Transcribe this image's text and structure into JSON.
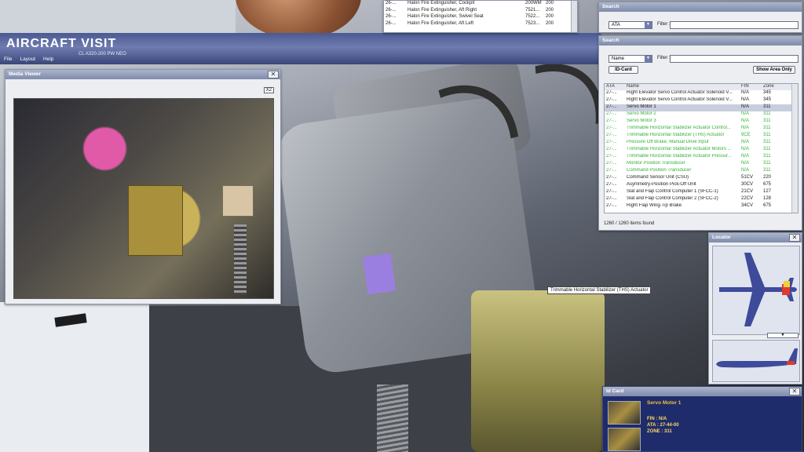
{
  "app": {
    "title": "AIRCRAFT VISIT",
    "subtitle": "CL A320-200 PW NEO"
  },
  "menu": [
    "File",
    "Layout",
    "Help"
  ],
  "top_list": {
    "rows": [
      {
        "ata": "26-...",
        "name": "Halon Fire Extinguisher, Cockpit",
        "fin": "200WM",
        "zone": "200"
      },
      {
        "ata": "26-...",
        "name": "Halon Fire Extinguisher, Aft Right",
        "fin": "7521...",
        "zone": "200"
      },
      {
        "ata": "26-...",
        "name": "Halon Fire Extinguisher, Swivel Seat",
        "fin": "7522...",
        "zone": "200"
      },
      {
        "ata": "26-...",
        "name": "Halon Fire Extinguisher, Aft Left",
        "fin": "7523...",
        "zone": "200"
      }
    ]
  },
  "search_small": {
    "title": "Search",
    "mode": "ATA",
    "filter_label": "Filter :"
  },
  "search_main": {
    "title": "Search",
    "mode": "Name",
    "filter_label": "Filter :",
    "id_card_btn": "ID-Card",
    "show_area_btn": "Show Area Only",
    "columns": [
      "ATA",
      "Name",
      "FIN",
      "Zone"
    ],
    "rows": [
      {
        "ata": "27-...",
        "name": "Right Elevator Servo Control Actuator Solenoid V...",
        "fin": "N/A",
        "zone": "345",
        "style": "normal"
      },
      {
        "ata": "27-...",
        "name": "Right Elevator Servo Control Actuator Solenoid V...",
        "fin": "N/A",
        "zone": "345",
        "style": "normal"
      },
      {
        "ata": "27-...",
        "name": "Servo Motor 1",
        "fin": "N/A",
        "zone": "311",
        "style": "sel"
      },
      {
        "ata": "27-...",
        "name": "Servo Motor 2",
        "fin": "N/A",
        "zone": "311",
        "style": "green"
      },
      {
        "ata": "27-...",
        "name": "Servo Motor 3",
        "fin": "N/A",
        "zone": "311",
        "style": "green"
      },
      {
        "ata": "27-...",
        "name": "Trimmable Horizontal Stabilizer Actuator Control...",
        "fin": "N/A",
        "zone": "311",
        "style": "green"
      },
      {
        "ata": "27-...",
        "name": "Trimmable Horizontal Stabilizer (THS) Actuator",
        "fin": "9CE",
        "zone": "311",
        "style": "green"
      },
      {
        "ata": "27-...",
        "name": "Pressure Off Brake, Manual Drive Input",
        "fin": "N/A",
        "zone": "311",
        "style": "green"
      },
      {
        "ata": "27-...",
        "name": "Trimmable Horizontal Stabilizer Actuator Motors ...",
        "fin": "N/A",
        "zone": "311",
        "style": "green"
      },
      {
        "ata": "27-...",
        "name": "Trimmable Horizontal Stabilizer Actuator Pressur...",
        "fin": "N/A",
        "zone": "311",
        "style": "green"
      },
      {
        "ata": "27-...",
        "name": "Monitor Position Transducer",
        "fin": "N/A",
        "zone": "311",
        "style": "green"
      },
      {
        "ata": "27-...",
        "name": "Command Position Transducer",
        "fin": "N/A",
        "zone": "311",
        "style": "green"
      },
      {
        "ata": "27-...",
        "name": "Command Sensor Unit (CSU)",
        "fin": "51CV",
        "zone": "220",
        "style": "normal"
      },
      {
        "ata": "27-...",
        "name": "Asymmetry-Position Pick-Off Unit",
        "fin": "30CV",
        "zone": "675",
        "style": "normal"
      },
      {
        "ata": "27-...",
        "name": "Slat and Flap Control Computer 1 (SFCC-1)",
        "fin": "21CV",
        "zone": "127",
        "style": "normal"
      },
      {
        "ata": "27-...",
        "name": "Slat and Flap Control Computer 2 (SFCC-2)",
        "fin": "22CV",
        "zone": "128",
        "style": "normal"
      },
      {
        "ata": "27-...",
        "name": "Right Flap Wing-Tip Brake",
        "fin": "34CV",
        "zone": "675",
        "style": "normal"
      }
    ],
    "found": "1260 / 1260 items found"
  },
  "media_viewer": {
    "title": "Media Viewer",
    "zoom_btn": "X2"
  },
  "locator": {
    "title": "Locator"
  },
  "id_card": {
    "title": "Id Card",
    "name": "Servo Motor 1",
    "fin": "FIN : N/A",
    "ata": "ATA : 27-44-00",
    "zone": "ZONE : 311"
  },
  "tooltip": "Trimmable Horizontal Stabilizer (THS) Actuator",
  "colors": {
    "header": "#4a5a92",
    "green_text": "#34b13a",
    "idcard_bg": "#1f2c6b"
  }
}
